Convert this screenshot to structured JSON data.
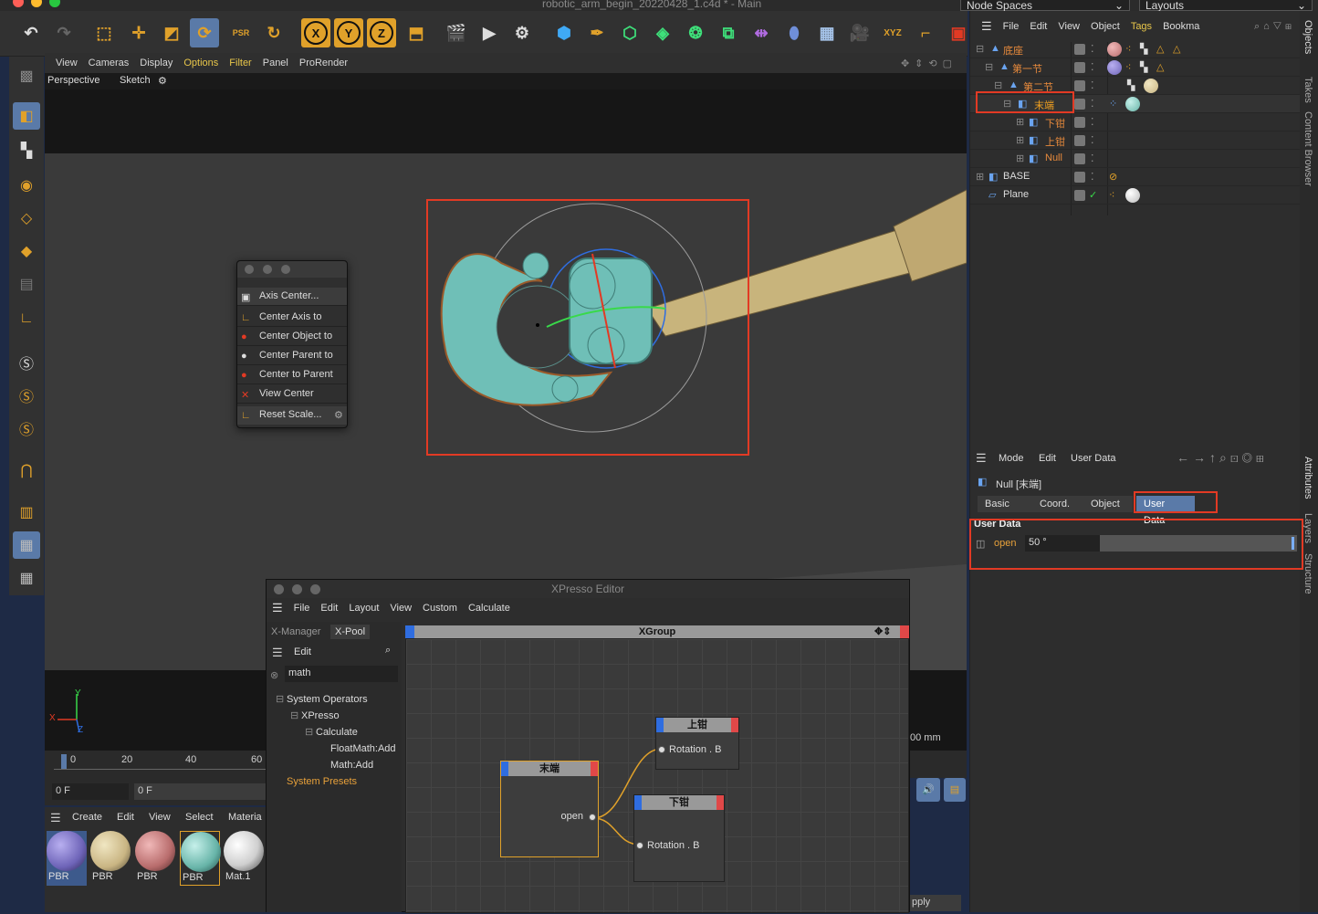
{
  "window": {
    "title": "robotic_arm_begin_20220428_1.c4d * - Main"
  },
  "top_dropdowns": {
    "node_spaces": "Node Spaces",
    "layouts": "Layouts"
  },
  "viewport": {
    "menu": [
      "View",
      "Cameras",
      "Display",
      "Options",
      "Filter",
      "Panel",
      "ProRender"
    ],
    "camera": "Perspective",
    "display_mode": "Sketch",
    "axis_labels": {
      "x": "X",
      "y": "Y",
      "z": "Z"
    },
    "measure": "00 mm"
  },
  "timeline": {
    "ticks": [
      "0",
      "20",
      "40",
      "60"
    ],
    "frame_start": "0 F",
    "frame_current": "0 F"
  },
  "material_manager": {
    "menu": [
      "Create",
      "Edit",
      "View",
      "Select",
      "Materia"
    ],
    "materials": [
      {
        "label": "PBR",
        "color": "#6e64b8"
      },
      {
        "label": "PBR",
        "color": "#c9b583"
      },
      {
        "label": "PBR",
        "color": "#b86c6c"
      },
      {
        "label": "PBR",
        "color": "#67b4a8"
      },
      {
        "label": "Mat.1",
        "color": "#cfcfcf"
      }
    ]
  },
  "popup": {
    "items": [
      "Axis Center...",
      "Center Axis to",
      "Center Object to",
      "Center Parent to",
      "Center to Parent",
      "View Center",
      "Reset Scale..."
    ]
  },
  "objects": {
    "menu": [
      "File",
      "Edit",
      "View",
      "Object",
      "Tags",
      "Bookma"
    ],
    "rows": [
      {
        "name": "底座",
        "color": "#e88a3c"
      },
      {
        "name": "第一节",
        "color": "#e88a3c"
      },
      {
        "name": "第二节",
        "color": "#e88a3c"
      },
      {
        "name": "末端",
        "color": "#f0a020"
      },
      {
        "name": "下钳",
        "color": "#e88a3c"
      },
      {
        "name": "上钳",
        "color": "#e88a3c"
      },
      {
        "name": "Null",
        "color": "#e88a3c"
      },
      {
        "name": "BASE",
        "color": "#dddddd"
      },
      {
        "name": "Plane",
        "color": "#dddddd"
      }
    ]
  },
  "side_tabs": [
    "Objects",
    "Takes",
    "Content Browser",
    "Attributes",
    "Layers",
    "Structure"
  ],
  "attributes": {
    "menu": [
      "Mode",
      "Edit",
      "User Data"
    ],
    "object_title": "Null [末端]",
    "tabs": [
      "Basic",
      "Coord.",
      "Object",
      "User Data"
    ],
    "section": "User Data",
    "field_label": "open",
    "field_value": "50 °",
    "slider_fraction": 1.0
  },
  "right_partial": {
    "apply": "pply"
  },
  "xpresso": {
    "title": "XPresso Editor",
    "menu": [
      "File",
      "Edit",
      "Layout",
      "View",
      "Custom",
      "Calculate"
    ],
    "tabs": [
      "X-Manager",
      "X-Pool"
    ],
    "pool_edit": "Edit",
    "search_value": "math",
    "tree": [
      "System Operators",
      "XPresso",
      "Calculate",
      "FloatMath:Add",
      "Math:Add",
      "System Presets"
    ],
    "group_title": "XGroup",
    "nodes": {
      "source": {
        "title": "末端",
        "port": "open"
      },
      "upper": {
        "title": "上钳",
        "port": "Rotation . B"
      },
      "lower": {
        "title": "下钳",
        "port": "Rotation . B"
      }
    }
  }
}
